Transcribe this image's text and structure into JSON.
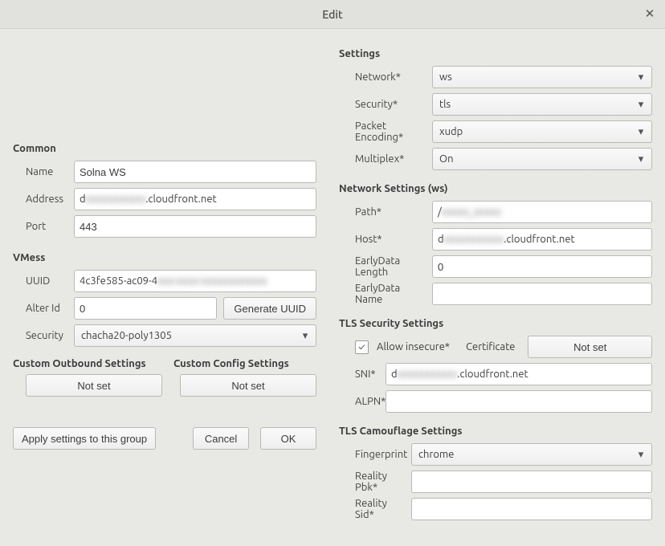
{
  "window": {
    "title": "Edit"
  },
  "common": {
    "heading": "Common",
    "labels": {
      "name": "Name",
      "address": "Address",
      "port": "Port"
    },
    "name": "Solna WS",
    "address_prefix": "d",
    "address_hidden": "xxxxxxxxxxx",
    "address_suffix": ".cloudfront.net",
    "port": "443"
  },
  "vmess": {
    "heading": "VMess",
    "labels": {
      "uuid": "UUID",
      "alter_id": "Alter Id",
      "security": "Security"
    },
    "uuid_prefix": "4c3fe585-ac09-4",
    "uuid_hidden": "xxx-xxxx-xxxxxxxxxxxx",
    "alter_id": "0",
    "security": "chacha20-poly1305",
    "generate_label": "Generate UUID"
  },
  "custom": {
    "outbound_heading": "Custom Outbound Settings",
    "config_heading": "Custom Config Settings",
    "not_set": "Not set"
  },
  "actions": {
    "apply_group": "Apply settings to this group",
    "cancel": "Cancel",
    "ok": "OK"
  },
  "settings": {
    "heading": "Settings",
    "labels": {
      "network": "Network*",
      "security": "Security*",
      "encoding": "Packet Encoding*",
      "multiplex": "Multiplex*"
    },
    "network": "ws",
    "security": "tls",
    "encoding": "xudp",
    "multiplex": "On"
  },
  "ws": {
    "heading": "Network Settings (ws)",
    "labels": {
      "path": "Path*",
      "host": "Host*",
      "early_len": "EarlyData Length",
      "early_name": "EarlyData Name"
    },
    "path_prefix": "/",
    "path_hidden": "xxxxx_xxxxx",
    "host_prefix": "d",
    "host_hidden": "xxxxxxxxxxx",
    "host_suffix": ".cloudfront.net",
    "early_len": "0",
    "early_name": ""
  },
  "tls": {
    "heading": "TLS Security Settings",
    "allow_insecure_label": "Allow insecure*",
    "allow_insecure_checked": "✓",
    "certificate_label": "Certificate",
    "cert_not_set": "Not set",
    "labels": {
      "sni": "SNI*",
      "alpn": "ALPN*"
    },
    "sni_prefix": "d",
    "sni_hidden": "xxxxxxxxxxx",
    "sni_suffix": ".cloudfront.net",
    "alpn": ""
  },
  "camo": {
    "heading": "TLS Camouflage Settings",
    "labels": {
      "fingerprint": "Fingerprint",
      "reality_pbk": "Reality Pbk*",
      "reality_sid": "Reality Sid*"
    },
    "fingerprint": "chrome",
    "reality_pbk": "",
    "reality_sid": ""
  }
}
